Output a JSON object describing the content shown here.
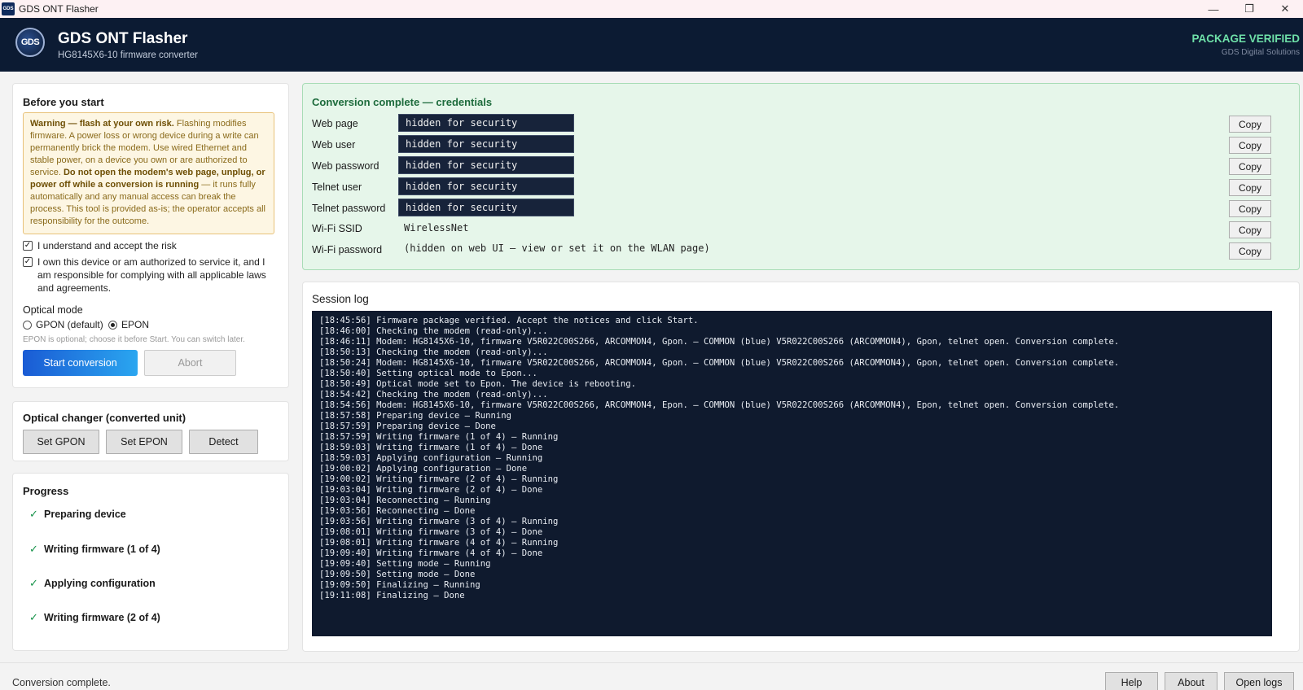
{
  "window": {
    "icon_text": "GDS",
    "title": "GDS ONT Flasher",
    "minimize": "—",
    "maximize": "❐",
    "close": "✕"
  },
  "header": {
    "logo_text": "GDS",
    "title": "GDS ONT Flasher",
    "subtitle": "HG8145X6-10 firmware converter",
    "package_status": "PACKAGE VERIFIED",
    "company": "GDS Digital Solutions",
    "status_color": "#6ee0a8"
  },
  "before_start": {
    "title": "Before you start",
    "warning_bold_1": "Warning — flash at your own risk.",
    "warning_text_1": " Flashing modifies firmware. A power loss or wrong device during a write can permanently brick the modem. Use wired Ethernet and stable power, on a device you own or are authorized to service. ",
    "warning_bold_2": "Do not open the modem's web page, unplug, or power off while a conversion is running",
    "warning_text_2": " — it runs fully automatically and any manual access can break the process. This tool is provided as-is; the operator accepts all responsibility for the outcome.",
    "check_risk": "I understand and accept the risk",
    "check_owner": "I own this device or am authorized to service it, and I am responsible for complying with all applicable laws and agreements.",
    "optical_mode_label": "Optical mode",
    "gpon_label": "GPON (default)",
    "epon_label": "EPON",
    "selected_mode": "EPON",
    "hint": "EPON is optional; choose it before Start. You can switch later.",
    "start_button": "Start conversion",
    "abort_button": "Abort"
  },
  "optical_changer": {
    "title": "Optical changer (converted unit)",
    "set_gpon": "Set GPON",
    "set_epon": "Set EPON",
    "detect": "Detect"
  },
  "progress": {
    "title": "Progress",
    "items": [
      {
        "label": "Preparing device",
        "status": "done"
      },
      {
        "label": "Writing firmware (1 of 4)",
        "status": "done"
      },
      {
        "label": "Applying configuration",
        "status": "done"
      },
      {
        "label": "Writing firmware (2 of 4)",
        "status": "done"
      }
    ],
    "check_glyph": "✓"
  },
  "credentials": {
    "title": "Conversion complete — credentials",
    "copy_label": "Copy",
    "rows": [
      {
        "label": "Web page",
        "value": "hidden for security"
      },
      {
        "label": "Web user",
        "value": "hidden for security"
      },
      {
        "label": "Web password",
        "value": "hidden for security"
      },
      {
        "label": "Telnet user",
        "value": "hidden for security"
      },
      {
        "label": "Telnet password",
        "value": "hidden for security"
      },
      {
        "label": "Wi-Fi SSID",
        "value": "WirelessNet"
      },
      {
        "label": "Wi-Fi password",
        "value": "(hidden on web UI — view or set it on the WLAN page)"
      }
    ]
  },
  "session_log": {
    "title": "Session log",
    "lines": [
      "[18:45:56] Firmware package verified. Accept the notices and click Start.",
      "[18:46:00] Checking the modem (read-only)...",
      "[18:46:11] Modem: HG8145X6-10, firmware V5R022C00S266, ARCOMMON4, Gpon. — COMMON (blue) V5R022C00S266 (ARCOMMON4), Gpon, telnet open. Conversion complete.",
      "[18:50:13] Checking the modem (read-only)...",
      "[18:50:24] Modem: HG8145X6-10, firmware V5R022C00S266, ARCOMMON4, Gpon. — COMMON (blue) V5R022C00S266 (ARCOMMON4), Gpon, telnet open. Conversion complete.",
      "[18:50:40] Setting optical mode to Epon...",
      "[18:50:49] Optical mode set to Epon. The device is rebooting.",
      "[18:54:42] Checking the modem (read-only)...",
      "[18:54:56] Modem: HG8145X6-10, firmware V5R022C00S266, ARCOMMON4, Epon. — COMMON (blue) V5R022C00S266 (ARCOMMON4), Epon, telnet open. Conversion complete.",
      "[18:57:58] Preparing device — Running",
      "[18:57:59] Preparing device — Done",
      "[18:57:59] Writing firmware (1 of 4) — Running",
      "[18:59:03] Writing firmware (1 of 4) — Done",
      "[18:59:03] Applying configuration — Running",
      "[19:00:02] Applying configuration — Done",
      "[19:00:02] Writing firmware (2 of 4) — Running",
      "[19:03:04] Writing firmware (2 of 4) — Done",
      "[19:03:04] Reconnecting — Running",
      "[19:03:56] Reconnecting — Done",
      "[19:03:56] Writing firmware (3 of 4) — Running",
      "[19:08:01] Writing firmware (3 of 4) — Done",
      "[19:08:01] Writing firmware (4 of 4) — Running",
      "[19:09:40] Writing firmware (4 of 4) — Done",
      "[19:09:40] Setting mode — Running",
      "[19:09:50] Setting mode — Done",
      "[19:09:50] Finalizing — Running",
      "[19:11:08] Finalizing — Done"
    ]
  },
  "statusbar": {
    "text": "Conversion complete.",
    "help": "Help",
    "about": "About",
    "open_logs": "Open logs"
  }
}
